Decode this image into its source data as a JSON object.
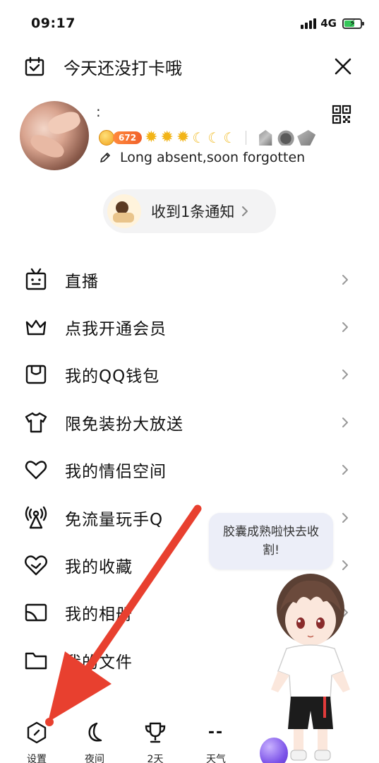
{
  "status_bar": {
    "time": "09:17",
    "network": "4G"
  },
  "checkin": {
    "text": "今天还没打卡哦"
  },
  "profile": {
    "nickname": ":",
    "level_points": "672",
    "signature": "Long absent,soon forgotten"
  },
  "notification": {
    "text": "收到1条通知"
  },
  "menu": {
    "items": [
      {
        "label": "直播",
        "icon": "live-tv-icon"
      },
      {
        "label": "点我开通会员",
        "icon": "crown-icon"
      },
      {
        "label": "我的QQ钱包",
        "icon": "wallet-icon"
      },
      {
        "label": "限免装扮大放送",
        "icon": "tshirt-icon"
      },
      {
        "label": "我的情侣空间",
        "icon": "heart-icon"
      },
      {
        "label": "免流量玩手Q",
        "icon": "signal-tower-icon"
      },
      {
        "label": "我的收藏",
        "icon": "heart-tag-icon"
      },
      {
        "label": "我的相册",
        "icon": "album-icon"
      },
      {
        "label": "我的文件",
        "icon": "folder-icon"
      }
    ]
  },
  "mascot": {
    "bubble_text": "胶囊成熟啦快去收割!"
  },
  "bottom_bar": {
    "settings": "设置",
    "night": "夜间",
    "days_label": "2天",
    "weather_value": "--",
    "weather": "天气"
  },
  "colors": {
    "annotation_arrow": "#e8402f",
    "coin": "#f0a21c",
    "level_pill": "#f0602a"
  }
}
